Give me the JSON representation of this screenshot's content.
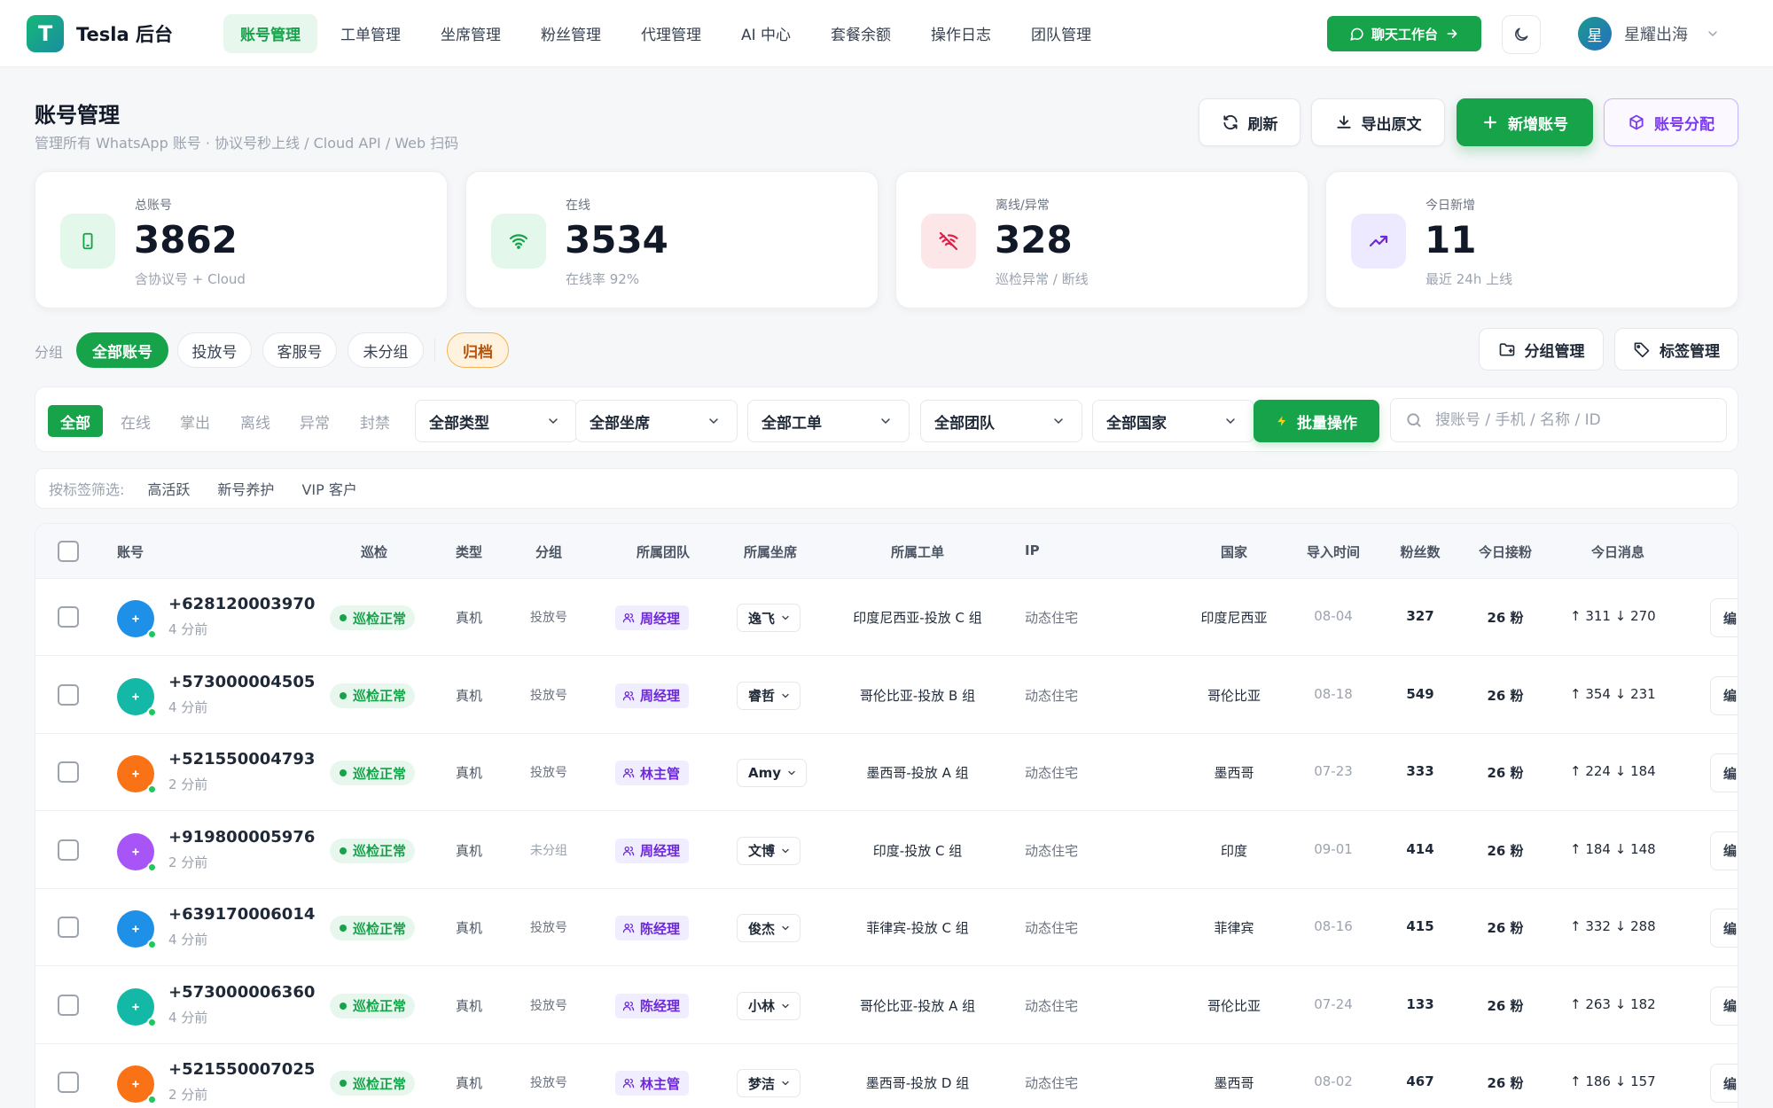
{
  "brand": {
    "logo_letter": "T",
    "name": "Tesla 后台"
  },
  "nav": [
    {
      "label": "账号管理",
      "active": true
    },
    {
      "label": "工单管理"
    },
    {
      "label": "坐席管理"
    },
    {
      "label": "粉丝管理"
    },
    {
      "label": "代理管理"
    },
    {
      "label": "AI 中心"
    },
    {
      "label": "套餐余额"
    },
    {
      "label": "操作日志"
    },
    {
      "label": "团队管理"
    }
  ],
  "topbar": {
    "chat_label": "聊天工作台",
    "user": {
      "avatar_letter": "星",
      "name": "星耀出海"
    }
  },
  "page": {
    "title": "账号管理",
    "subtitle": "管理所有 WhatsApp 账号 · 协议号秒上线 / Cloud API / Web 扫码",
    "buttons": {
      "refresh": "刷新",
      "export": "导出原文",
      "add": "新增账号",
      "assign": "账号分配"
    }
  },
  "stats": [
    {
      "label": "总账号",
      "value": "3862",
      "note": "含协议号 + Cloud",
      "icon": "phone-icon"
    },
    {
      "label": "在线",
      "value": "3534",
      "note": "在线率 92%",
      "icon": "wifi-icon"
    },
    {
      "label": "离线/异常",
      "value": "328",
      "note": "巡检异常 / 断线",
      "icon": "wifi-off-icon"
    },
    {
      "label": "今日新增",
      "value": "11",
      "note": "最近 24h 上线",
      "icon": "trending-up-icon"
    }
  ],
  "groups": {
    "label": "分组",
    "items": [
      "全部账号",
      "投放号",
      "客服号",
      "未分组"
    ],
    "archive": "归档",
    "manage_group": "分组管理",
    "manage_tag": "标签管理"
  },
  "filters": {
    "status": [
      "全部",
      "在线",
      "掌出",
      "离线",
      "异常",
      "封禁"
    ],
    "selects": [
      "全部类型",
      "全部坐席",
      "全部工单",
      "全部团队",
      "全部国家"
    ],
    "batch": "批量操作",
    "search_placeholder": "搜账号 / 手机 / 名称 / ID"
  },
  "tag_filter": {
    "label": "按标签筛选:",
    "tags": [
      "高活跃",
      "新号养护",
      "VIP 客户"
    ]
  },
  "table": {
    "columns": [
      "账号",
      "巡检",
      "类型",
      "分组",
      "所属团队",
      "所属坐席",
      "所属工单",
      "IP",
      "国家",
      "导入时间",
      "粉丝数",
      "今日接粉",
      "今日消息"
    ],
    "op_label": "编",
    "rows": [
      {
        "phone": "+628120003970",
        "time": "4 分前",
        "check": "巡检正常",
        "type": "真机",
        "group": "投放号",
        "team": "周经理",
        "seat": "逸飞",
        "order": "印度尼西亚-投放 C 组",
        "ip": "动态住宅",
        "country": "印度尼西亚",
        "date": "08-04",
        "fans": "327",
        "today_fans": "26 粉",
        "msg": "↑ 311 ↓ 270",
        "color": "#1e90e8"
      },
      {
        "phone": "+573000004505",
        "time": "4 分前",
        "check": "巡检正常",
        "type": "真机",
        "group": "投放号",
        "team": "周经理",
        "seat": "睿哲",
        "order": "哥伦比亚-投放 B 组",
        "ip": "动态住宅",
        "country": "哥伦比亚",
        "date": "08-18",
        "fans": "549",
        "today_fans": "26 粉",
        "msg": "↑ 354 ↓ 231",
        "color": "#14b8a6"
      },
      {
        "phone": "+521550004793",
        "time": "2 分前",
        "check": "巡检正常",
        "type": "真机",
        "group": "投放号",
        "team": "林主管",
        "seat": "Amy",
        "order": "墨西哥-投放 A 组",
        "ip": "动态住宅",
        "country": "墨西哥",
        "date": "07-23",
        "fans": "333",
        "today_fans": "26 粉",
        "msg": "↑ 224 ↓ 184",
        "color": "#f97316"
      },
      {
        "phone": "+919800005976",
        "time": "2 分前",
        "check": "巡检正常",
        "type": "真机",
        "group": "未分组",
        "team": "周经理",
        "seat": "文博",
        "order": "印度-投放 C 组",
        "ip": "动态住宅",
        "country": "印度",
        "date": "09-01",
        "fans": "414",
        "today_fans": "26 粉",
        "msg": "↑ 184 ↓ 148",
        "color": "#a855f7",
        "group_muted": true
      },
      {
        "phone": "+639170006014",
        "time": "4 分前",
        "check": "巡检正常",
        "type": "真机",
        "group": "投放号",
        "team": "陈经理",
        "seat": "俊杰",
        "order": "菲律宾-投放 C 组",
        "ip": "动态住宅",
        "country": "菲律宾",
        "date": "08-16",
        "fans": "415",
        "today_fans": "26 粉",
        "msg": "↑ 332 ↓ 288",
        "color": "#1e90e8"
      },
      {
        "phone": "+573000006360",
        "time": "4 分前",
        "check": "巡检正常",
        "type": "真机",
        "group": "投放号",
        "team": "陈经理",
        "seat": "小林",
        "order": "哥伦比亚-投放 A 组",
        "ip": "动态住宅",
        "country": "哥伦比亚",
        "date": "07-24",
        "fans": "133",
        "today_fans": "26 粉",
        "msg": "↑ 263 ↓ 182",
        "color": "#14b8a6"
      },
      {
        "phone": "+521550007025",
        "time": "2 分前",
        "check": "巡检正常",
        "type": "真机",
        "group": "投放号",
        "team": "林主管",
        "seat": "梦洁",
        "order": "墨西哥-投放 D 组",
        "ip": "动态住宅",
        "country": "墨西哥",
        "date": "08-02",
        "fans": "467",
        "today_fans": "26 粉",
        "msg": "↑ 186 ↓ 157",
        "color": "#f97316"
      }
    ]
  }
}
